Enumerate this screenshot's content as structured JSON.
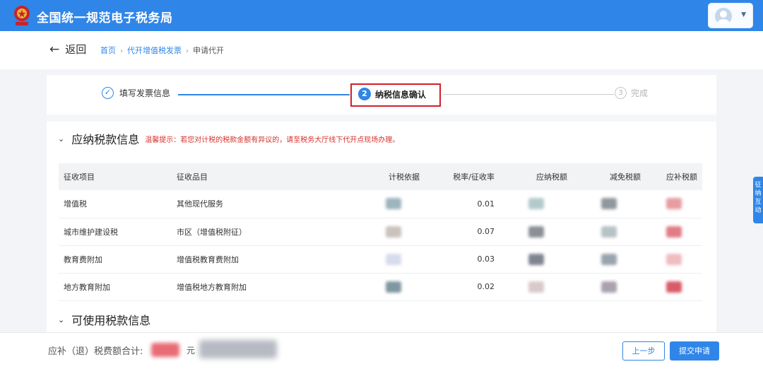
{
  "header": {
    "site_title": "全国统一规范电子税务局"
  },
  "nav": {
    "back_label": "返回",
    "breadcrumbs": [
      "首页",
      "代开增值税发票",
      "申请代开"
    ]
  },
  "steps": [
    {
      "label": "填写发票信息",
      "state": "done"
    },
    {
      "number": "2",
      "label": "纳税信息确认",
      "state": "active"
    },
    {
      "number": "3",
      "label": "完成",
      "state": "pending"
    }
  ],
  "tax_section": {
    "title": "应纳税款信息",
    "tip": "温馨提示：若您对计税的税款金额有异议的，请至税务大厅线下代开点现场办理。",
    "columns": [
      "征收项目",
      "征收品目",
      "计税依据",
      "税率/征收率",
      "应纳税额",
      "减免税额",
      "应补税额"
    ],
    "rows": [
      {
        "item": "增值税",
        "category": "其他现代服务",
        "rate": "0.01"
      },
      {
        "item": "城市维护建设税",
        "category": "市区（增值税附征）",
        "rate": "0.07"
      },
      {
        "item": "教育费附加",
        "category": "增值税教育费附加",
        "rate": "0.03"
      },
      {
        "item": "地方教育附加",
        "category": "增值税地方教育附加",
        "rate": "0.02"
      }
    ]
  },
  "usable_section": {
    "title": "可使用税款信息"
  },
  "side_tab": {
    "label": "征纳互动"
  },
  "footer": {
    "total_label": "应补（退）税费额合计:",
    "unit": "元",
    "prev_button": "上一步",
    "submit_button": "提交申请"
  },
  "colors": {
    "primary": "#2f86e8",
    "highlight_box": "#d1202a",
    "tip_text": "#d4322c"
  }
}
